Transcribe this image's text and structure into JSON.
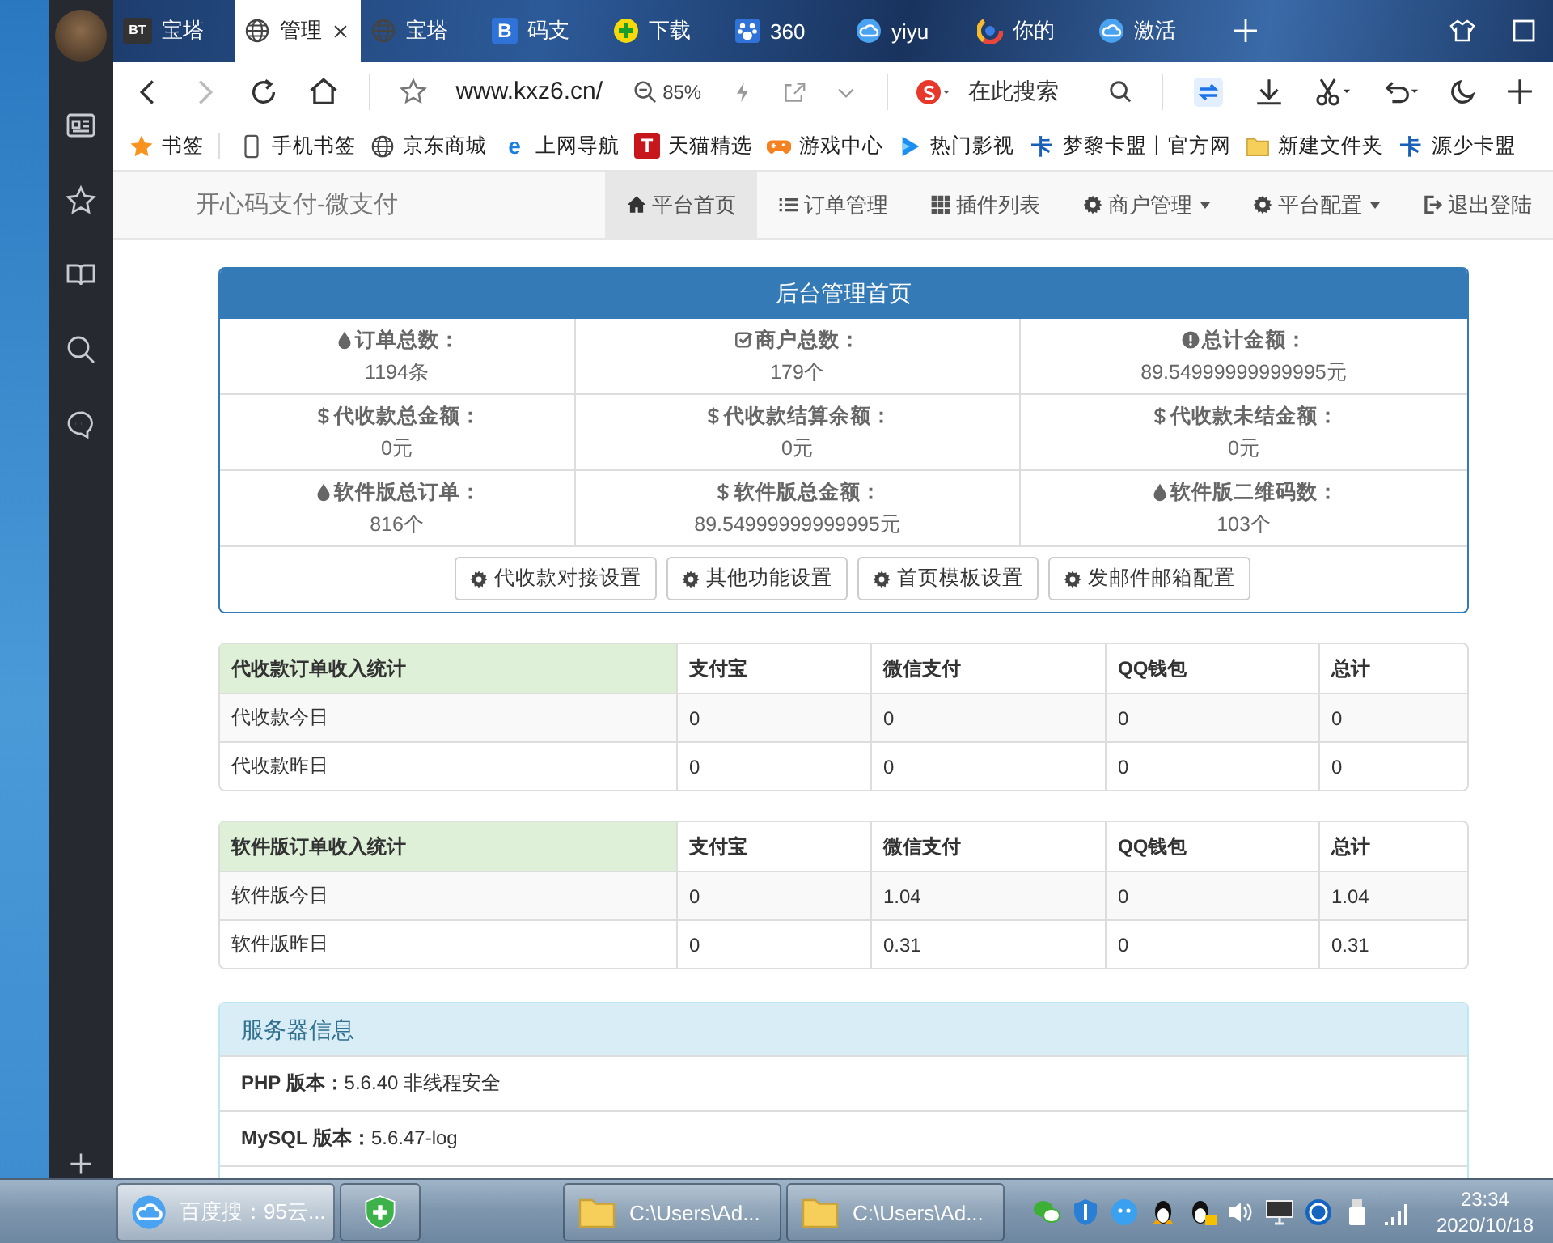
{
  "browser": {
    "tabs": [
      {
        "label": "宝塔",
        "kind": "letter-dark",
        "badge": "BT",
        "selected": false
      },
      {
        "label": "管理",
        "kind": "globe",
        "selected": true
      },
      {
        "label": "宝塔",
        "kind": "globe",
        "selected": false
      },
      {
        "label": "码支",
        "kind": "letter-blue",
        "badge": "B",
        "selected": false
      },
      {
        "label": "下载",
        "kind": "plus-green",
        "selected": false
      },
      {
        "label": "360",
        "kind": "paw",
        "selected": false
      },
      {
        "label": "yiyu",
        "kind": "cloud",
        "selected": false
      },
      {
        "label": "你的",
        "kind": "ring",
        "selected": false
      },
      {
        "label": "激活",
        "kind": "cloud",
        "selected": false
      }
    ],
    "address": "www.kxz6.cn/",
    "zoom": "85%",
    "search_placeholder": "在此搜索",
    "bookmarks": [
      {
        "label": "书签",
        "kind": "star"
      },
      {
        "label": "手机书签",
        "kind": "phone"
      },
      {
        "label": "京东商城",
        "kind": "globe"
      },
      {
        "label": "上网导航",
        "kind": "letter-e",
        "badge": "e"
      },
      {
        "label": "天猫精选",
        "kind": "letter-red",
        "badge": "T"
      },
      {
        "label": "游戏中心",
        "kind": "gamepad"
      },
      {
        "label": "热门影视",
        "kind": "play"
      },
      {
        "label": "梦黎卡盟丨官方网",
        "kind": "letter-card",
        "badge": "卡"
      },
      {
        "label": "新建文件夹",
        "kind": "folder"
      },
      {
        "label": "源少卡盟",
        "kind": "letter-card",
        "badge": "卡"
      }
    ]
  },
  "navbar": {
    "brand": "开心码支付-微支付",
    "items": [
      {
        "label": "平台首页",
        "kind": "home",
        "selected": true,
        "dropdown": false
      },
      {
        "label": "订单管理",
        "kind": "list",
        "selected": false,
        "dropdown": false
      },
      {
        "label": "插件列表",
        "kind": "grid",
        "selected": false,
        "dropdown": false
      },
      {
        "label": "商户管理",
        "kind": "gear",
        "selected": false,
        "dropdown": true
      },
      {
        "label": "平台配置",
        "kind": "gear",
        "selected": false,
        "dropdown": true
      },
      {
        "label": "退出登陆",
        "kind": "logout",
        "selected": false,
        "dropdown": false
      }
    ]
  },
  "overview": {
    "title": "后台管理首页",
    "stats": [
      {
        "kind": "drop",
        "label": "订单总数：",
        "value": "1194条"
      },
      {
        "kind": "check",
        "label": "商户总数：",
        "value": "179个"
      },
      {
        "kind": "info",
        "label": "总计金额：",
        "value": "89.54999999999995元"
      },
      {
        "kind": "dollar",
        "label": "代收款总金额：",
        "value": "0元"
      },
      {
        "kind": "dollar",
        "label": "代收款结算余额：",
        "value": "0元"
      },
      {
        "kind": "dollar",
        "label": "代收款未结金额：",
        "value": "0元"
      },
      {
        "kind": "drop",
        "label": "软件版总订单：",
        "value": "816个"
      },
      {
        "kind": "dollar",
        "label": "软件版总金额：",
        "value": "89.54999999999995元"
      },
      {
        "kind": "drop",
        "label": "软件版二维码数：",
        "value": "103个"
      }
    ],
    "buttons": [
      "代收款对接设置",
      "其他功能设置",
      "首页模板设置",
      "发邮件邮箱配置"
    ]
  },
  "tables": [
    {
      "columns": [
        "代收款订单收入统计",
        "支付宝",
        "微信支付",
        "QQ钱包",
        "总计"
      ],
      "rows": [
        [
          "代收款今日",
          "0",
          "0",
          "0",
          "0"
        ],
        [
          "代收款昨日",
          "0",
          "0",
          "0",
          "0"
        ]
      ]
    },
    {
      "columns": [
        "软件版订单收入统计",
        "支付宝",
        "微信支付",
        "QQ钱包",
        "总计"
      ],
      "rows": [
        [
          "软件版今日",
          "0",
          "1.04",
          "0",
          "1.04"
        ],
        [
          "软件版昨日",
          "0",
          "0.31",
          "0",
          "0.31"
        ]
      ]
    }
  ],
  "server_info": {
    "title": "服务器信息",
    "rows": [
      {
        "label": "PHP 版本：",
        "value": "5.6.40 非线程安全"
      },
      {
        "label": "MySQL 版本：",
        "value": "5.6.47-log"
      }
    ]
  },
  "taskbar": {
    "items": [
      {
        "label": "百度搜：95云...",
        "kind": "cloud",
        "selected": true
      },
      {
        "kind": "shield",
        "selected": false
      },
      {
        "label": "C:\\Users\\Ad...",
        "kind": "folder",
        "selected": false
      },
      {
        "label": "C:\\Users\\Ad...",
        "kind": "folder",
        "selected": false
      }
    ],
    "time": "23:34",
    "date": "2020/10/18"
  }
}
